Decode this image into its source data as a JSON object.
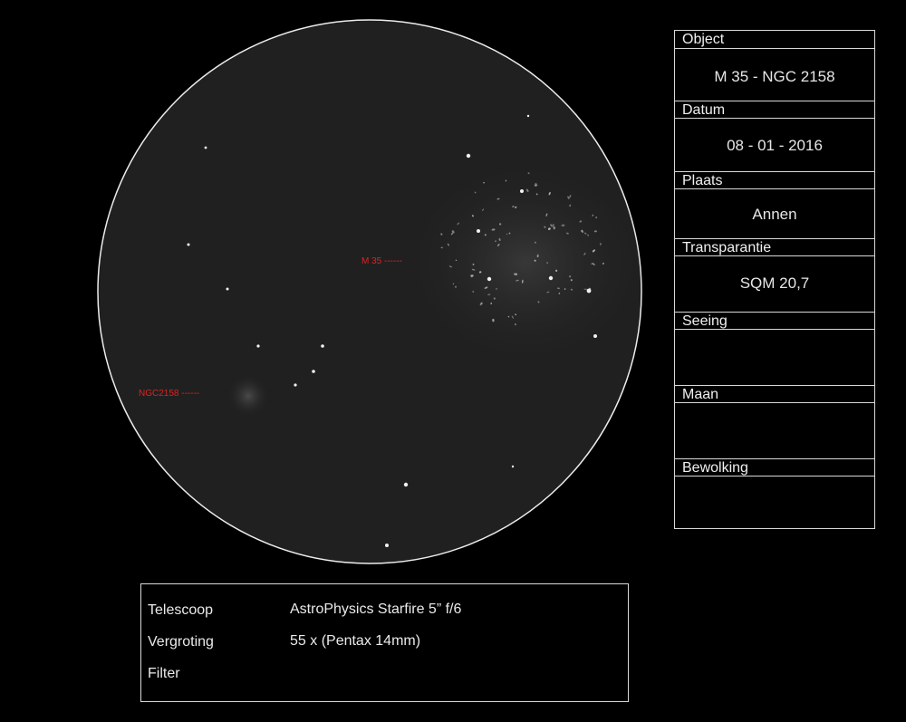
{
  "sketch": {
    "labels": {
      "m35": "M 35 ------",
      "ngc2158": "NGC2158 ------"
    },
    "colors": {
      "background": "#000000",
      "field": "#202020",
      "annotation": "#e02020"
    }
  },
  "info": {
    "object": {
      "label": "Object",
      "value": "M 35 - NGC 2158"
    },
    "date": {
      "label": "Datum",
      "value": "08 - 01 - 2016"
    },
    "place": {
      "label": "Plaats",
      "value": "Annen"
    },
    "transparency": {
      "label": "Transparantie",
      "value": "SQM 20,7"
    },
    "seeing": {
      "label": "Seeing",
      "value": ""
    },
    "moon": {
      "label": "Maan",
      "value": ""
    },
    "clouds": {
      "label": "Bewolking",
      "value": ""
    }
  },
  "equipment": {
    "telescope": {
      "label": "Telescoop",
      "value": "AstroPhysics Starfire 5” f/6"
    },
    "magnification": {
      "label": "Vergroting",
      "value": "55 x (Pentax 14mm)"
    },
    "filter": {
      "label": "Filter",
      "value": ""
    }
  }
}
